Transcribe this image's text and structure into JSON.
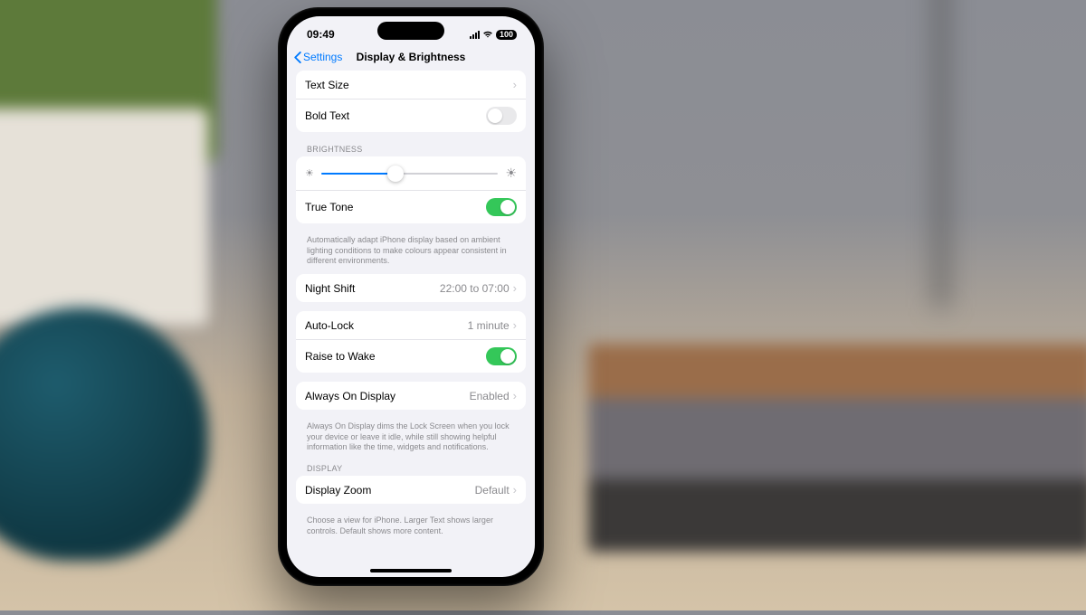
{
  "status": {
    "time": "09:49",
    "battery": "100"
  },
  "nav": {
    "back": "Settings",
    "title": "Display & Brightness"
  },
  "text_size": {
    "label": "Text Size"
  },
  "bold_text": {
    "label": "Bold Text"
  },
  "brightness_header": "BRIGHTNESS",
  "true_tone": {
    "label": "True Tone"
  },
  "true_tone_footer": "Automatically adapt iPhone display based on ambient lighting conditions to make colours appear consistent in different environments.",
  "night_shift": {
    "label": "Night Shift",
    "value": "22:00 to 07:00"
  },
  "auto_lock": {
    "label": "Auto-Lock",
    "value": "1 minute"
  },
  "raise_wake": {
    "label": "Raise to Wake"
  },
  "aod": {
    "label": "Always On Display",
    "value": "Enabled"
  },
  "aod_footer": "Always On Display dims the Lock Screen when you lock your device or leave it idle, while still showing helpful information like the time, widgets and notifications.",
  "display_header": "DISPLAY",
  "zoom": {
    "label": "Display Zoom",
    "value": "Default"
  },
  "zoom_footer": "Choose a view for iPhone. Larger Text shows larger controls. Default shows more content."
}
